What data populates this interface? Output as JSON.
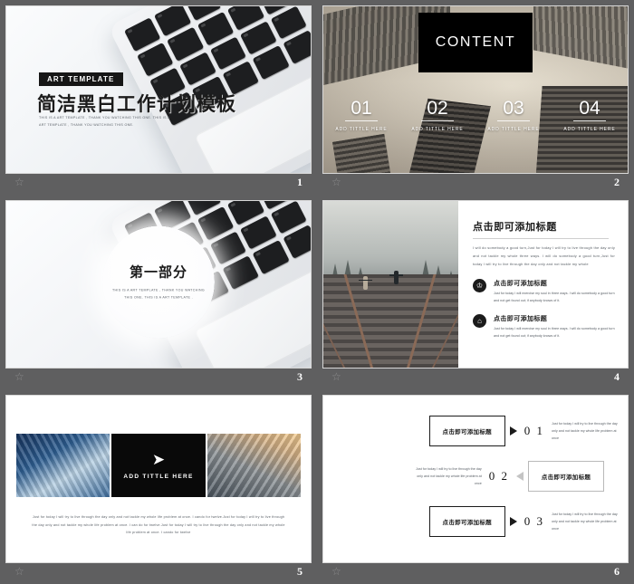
{
  "theme": {
    "background": "#5f5f60",
    "accent": "#000000",
    "slide_bg": "#ffffff"
  },
  "slides": [
    {
      "page_number": "1",
      "star_icon": "star-icon",
      "badge": "ART TEMPLATE",
      "title": "简洁黑白工作计划模板",
      "subtitle": "THIS IS A ART TEMPLATE , THANK YOU WATCHING THIS ONE. THIS IS A ART TEMPLATE , THANK YOU WATCHING THIS ONE."
    },
    {
      "page_number": "2",
      "star_icon": "star-icon",
      "heading": "CONTENT",
      "items": [
        {
          "num": "01",
          "caption": "ADD TITTLE HERE"
        },
        {
          "num": "02",
          "caption": "ADD TITTLE HERE"
        },
        {
          "num": "03",
          "caption": "ADD TITTLE HERE"
        },
        {
          "num": "04",
          "caption": "ADD TITTLE HERE"
        }
      ]
    },
    {
      "page_number": "3",
      "star_icon": "star-icon",
      "title": "第一部分",
      "subtitle": "THIS IS A ART TEMPLATE , THANK YOU WATCHING THIS ONE. THIS IS A ART TEMPLATE ."
    },
    {
      "page_number": "4",
      "star_icon": "star-icon",
      "title": "点击即可添加标题",
      "paragraph": "I will do somebody a good turn,Just for today I will try to live through the day only and not tackle my whole three ways. I will do somebody a good turn,Just for today I will try to live through the day only and not tackle my whole",
      "features": [
        {
          "icon": "trophy-icon",
          "glyph": "♔",
          "title": "点击即可添加标题",
          "text": "Just for today I will exercise my soul in three ways. I will do somebody a good turn and not get found out; if anybody knows of it."
        },
        {
          "icon": "home-icon",
          "glyph": "⌂",
          "title": "点击即可添加标题",
          "text": "Just for today I will exercise my soul in three ways. I will do somebody a good turn and not get found out; if anybody knows of it."
        }
      ]
    },
    {
      "page_number": "5",
      "star_icon": "star-icon",
      "panel_label": "ADD TITTLE HERE",
      "plane_icon": "paper-plane-icon",
      "plane_glyph": "➤",
      "paragraph": "Just for today I will try to live through the day only and not tackle my whole life problem at once. I cando for twelve.Just for today I will try to live through the day only and not tackle my whole life problem at once. I can do for twelve.Just for today I will try to live through the day only and not tackle my whole life problem at once. I cando for twelve"
    },
    {
      "page_number": "6",
      "star_icon": "star-icon",
      "rows": [
        {
          "box": "点击即可添加标题",
          "num": "0 1",
          "text": "Just for today I will try to live through the day only and not tackle my whole life problem at once"
        },
        {
          "box": "点击即可添加标题",
          "num": "0 2",
          "text": "Just for today I will try to live through the day only and not tackle my whole life problem at once"
        },
        {
          "box": "点击即可添加标题",
          "num": "0 3",
          "text": "Just for today I will try to live through the day only and not tackle my whole life problem at once"
        }
      ]
    }
  ]
}
